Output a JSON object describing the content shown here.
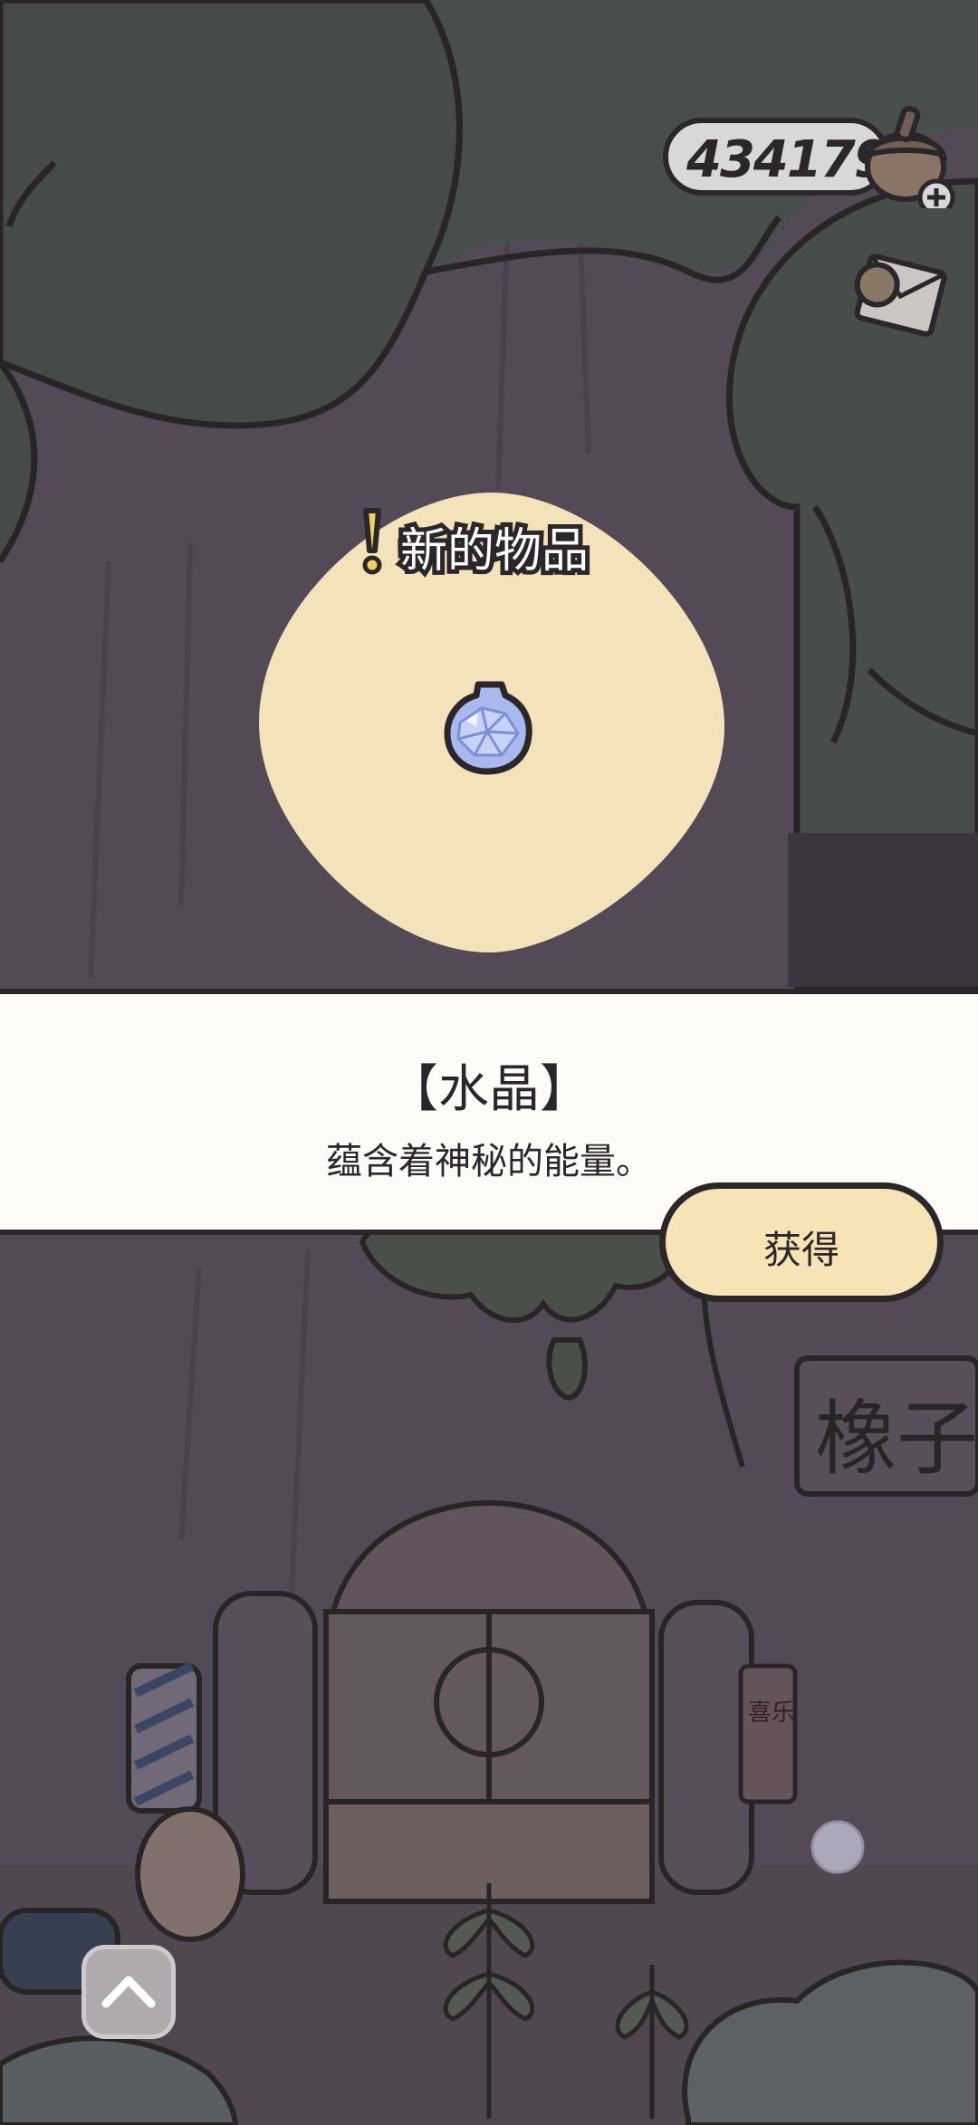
{
  "currency": {
    "amount": "434179",
    "icon": "acorn-icon",
    "add_icon": "plus-icon"
  },
  "side_icons": {
    "letter": "letter-icon"
  },
  "new_item": {
    "label": "新的物品",
    "alert_icon": "exclamation-icon",
    "item_icon": "crystal-icon"
  },
  "info": {
    "title": "【水晶】",
    "description": "蕴含着神秘的能量。"
  },
  "actions": {
    "obtain_label": "获得",
    "up_icon": "chevron-up-icon"
  },
  "scene": {
    "sign_text": "橡子",
    "scroll_text": "喜乐"
  },
  "colors": {
    "outline": "#2b2629",
    "panel_bg": "#fcfbf7",
    "button_bg": "#f6e4b6",
    "highlight_blob": "#f4e3ba",
    "scene_dark": "#4a4f4d",
    "scene_trunk": "#5a4f5d"
  }
}
